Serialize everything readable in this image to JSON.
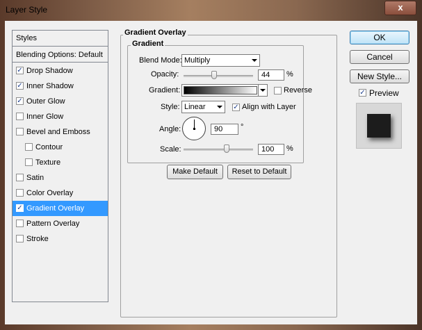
{
  "window": {
    "title": "Layer Style",
    "close_glyph": "x"
  },
  "styles_panel": {
    "header": "Styles",
    "blending_options": "Blending Options: Default",
    "items": [
      {
        "label": "Drop Shadow",
        "checked": true
      },
      {
        "label": "Inner Shadow",
        "checked": true
      },
      {
        "label": "Outer Glow",
        "checked": true
      },
      {
        "label": "Inner Glow",
        "checked": false
      },
      {
        "label": "Bevel and Emboss",
        "checked": false
      },
      {
        "label": "Contour",
        "checked": false
      },
      {
        "label": "Texture",
        "checked": false
      },
      {
        "label": "Satin",
        "checked": false
      },
      {
        "label": "Color Overlay",
        "checked": false
      },
      {
        "label": "Gradient Overlay",
        "checked": true,
        "selected": true
      },
      {
        "label": "Pattern Overlay",
        "checked": false
      },
      {
        "label": "Stroke",
        "checked": false
      }
    ]
  },
  "gradient_overlay": {
    "group_title": "Gradient Overlay",
    "subgroup_title": "Gradient",
    "blend_mode_label": "Blend Mode:",
    "blend_mode_value": "Multiply",
    "opacity_label": "Opacity:",
    "opacity_value": "44",
    "opacity_fraction": 0.44,
    "percent": "%",
    "gradient_label": "Gradient:",
    "gradient_colors": [
      "#000000",
      "#ffffff"
    ],
    "reverse_label": "Reverse",
    "reverse_checked": false,
    "style_label": "Style:",
    "style_value": "Linear",
    "align_label": "Align with Layer",
    "align_checked": true,
    "angle_label": "Angle:",
    "angle_value": "90",
    "degree": "°",
    "scale_label": "Scale:",
    "scale_value": "100",
    "make_default": "Make Default",
    "reset_default": "Reset to Default"
  },
  "actions": {
    "ok": "OK",
    "cancel": "Cancel",
    "new_style": "New Style...",
    "preview_label": "Preview",
    "preview_checked": true
  },
  "check_glyph": "✓",
  "colors": {
    "selection": "#3399ff",
    "dialog_bg": "#f0f0f0"
  }
}
